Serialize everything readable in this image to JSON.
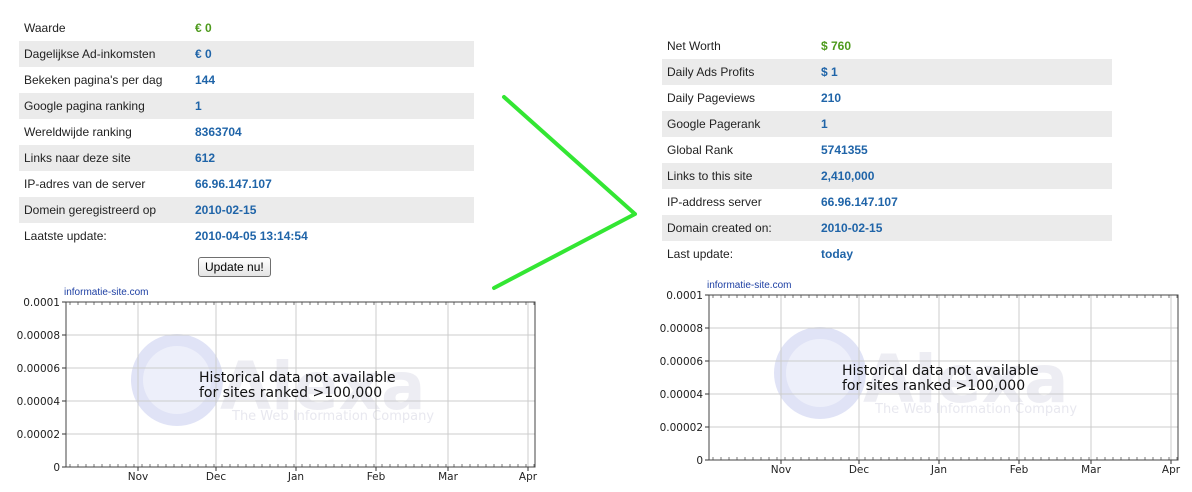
{
  "left_panel": {
    "rows": [
      {
        "label": "Waarde",
        "value": "€ 0",
        "value_color": "green"
      },
      {
        "label": "Dagelijkse Ad-inkomsten",
        "value": "€ 0",
        "value_color": "blue"
      },
      {
        "label": "Bekeken pagina's per dag",
        "value": "144",
        "value_color": "blue"
      },
      {
        "label": "Google pagina ranking",
        "value": "1",
        "value_color": "blue"
      },
      {
        "label": "Wereldwijde ranking",
        "value": "8363704",
        "value_color": "blue"
      },
      {
        "label": "Links naar deze site",
        "value": "612",
        "value_color": "blue"
      },
      {
        "label": "IP-adres van de server",
        "value": "66.96.147.107",
        "value_color": "blue"
      },
      {
        "label": "Domein geregistreerd op",
        "value": "2010-02-15",
        "value_color": "blue"
      },
      {
        "label": "Laatste update:",
        "value": "2010-04-05 13:14:54",
        "value_color": "blue"
      }
    ],
    "update_button": "Update nu!",
    "chart_source": "informatie-site.com"
  },
  "right_panel": {
    "rows": [
      {
        "label": "Net Worth",
        "value": "$ 760",
        "value_color": "green"
      },
      {
        "label": "Daily Ads Profits",
        "value": "$ 1",
        "value_color": "blue"
      },
      {
        "label": "Daily Pageviews",
        "value": "210",
        "value_color": "blue"
      },
      {
        "label": "Google Pagerank",
        "value": "1",
        "value_color": "blue"
      },
      {
        "label": "Global Rank",
        "value": "5741355",
        "value_color": "blue"
      },
      {
        "label": "Links to this site",
        "value": "2,410,000",
        "value_color": "blue"
      },
      {
        "label": "IP-address server",
        "value": "66.96.147.107",
        "value_color": "blue"
      },
      {
        "label": "Domain created on:",
        "value": "2010-02-15",
        "value_color": "blue"
      },
      {
        "label": "Last update:",
        "value": "today",
        "value_color": "blue"
      }
    ],
    "chart_source": "informatie-site.com"
  },
  "colors": {
    "label": "#222222",
    "value_blue": "#1f64a8",
    "value_green": "#4d9a1c",
    "row_shade": "#ebebeb",
    "arrow": "#33e633"
  },
  "chart_data": [
    {
      "type": "line",
      "series": [],
      "x_ticks": [
        "Nov",
        "Dec",
        "Jan",
        "Feb",
        "Mar",
        "Apr"
      ],
      "y_ticks": [
        "0",
        "0.00002",
        "0.00004",
        "0.00006",
        "0.00008",
        "0.0001"
      ],
      "ylim": [
        0,
        0.0001
      ],
      "grid": true,
      "message_line1": "Historical data not available",
      "message_line2": "for sites ranked >100,000",
      "watermark": "Alexa",
      "watermark_tagline": "The Web Information Company"
    },
    {
      "type": "line",
      "series": [],
      "x_ticks": [
        "Nov",
        "Dec",
        "Jan",
        "Feb",
        "Mar",
        "Apr"
      ],
      "y_ticks": [
        "0",
        "0.00002",
        "0.00004",
        "0.00006",
        "0.00008",
        "0.0001"
      ],
      "ylim": [
        0,
        0.0001
      ],
      "grid": true,
      "message_line1": "Historical data not available",
      "message_line2": "for sites ranked >100,000",
      "watermark": "Alexa",
      "watermark_tagline": "The Web Information Company"
    }
  ]
}
